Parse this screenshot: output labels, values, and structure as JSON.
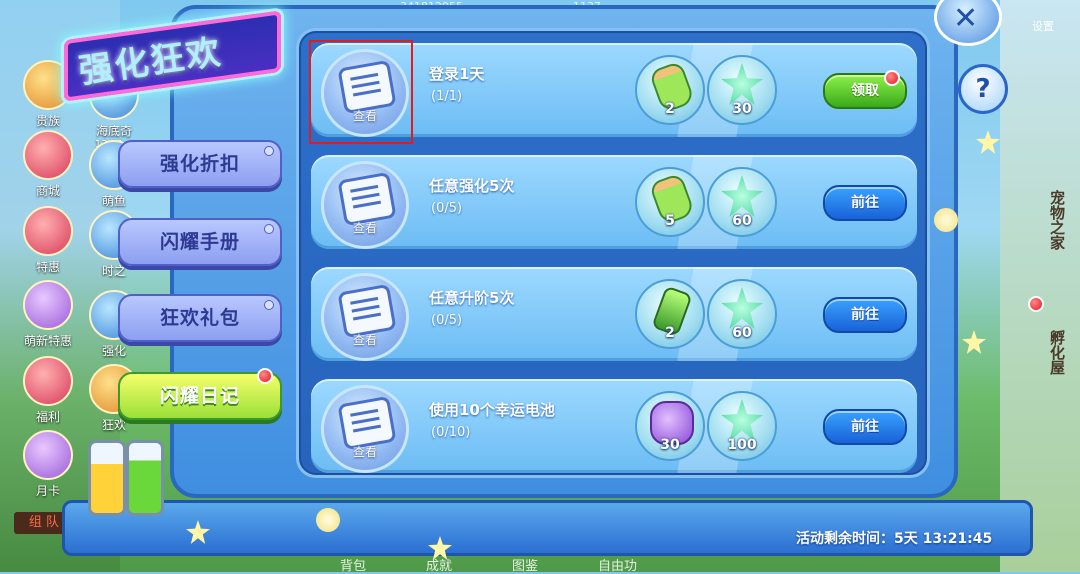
{
  "title": "强化狂欢",
  "top_strip": [
    "341812955",
    "1137"
  ],
  "settings_label": "设置",
  "left_icons": [
    {
      "label": "贵族",
      "style": ""
    },
    {
      "label": "海底奇",
      "style": "b"
    },
    {
      "label": "商城",
      "style": "r"
    },
    {
      "label": "萌鱼",
      "style": "b"
    },
    {
      "label": "特惠",
      "style": "r"
    },
    {
      "label": "时之",
      "style": "b"
    },
    {
      "label": "萌新特惠",
      "style": "p"
    },
    {
      "label": "强化",
      "style": "b"
    },
    {
      "label": "福利",
      "style": "r"
    },
    {
      "label": "狂欢",
      "style": ""
    },
    {
      "label": "月卡",
      "style": "p"
    }
  ],
  "left_icon_time": "13:21:4",
  "right_labels": [
    "宠物之家",
    "孵化屋"
  ],
  "tabs": [
    {
      "label": "强化折扣"
    },
    {
      "label": "闪耀手册"
    },
    {
      "label": "狂欢礼包"
    },
    {
      "label": "闪耀日记"
    }
  ],
  "tasks": [
    {
      "title": "登录1天",
      "progress": "(1/1)",
      "thumb_caption": "查看",
      "rewards": [
        {
          "icon": "potion",
          "qty": "2"
        },
        {
          "icon": "star",
          "qty": "30"
        }
      ],
      "button": "领取",
      "button_style": "green"
    },
    {
      "title": "任意强化5次",
      "progress": "(0/5)",
      "thumb_caption": "查看",
      "rewards": [
        {
          "icon": "potion",
          "qty": "5"
        },
        {
          "icon": "star",
          "qty": "60"
        }
      ],
      "button": "前往",
      "button_style": "blue"
    },
    {
      "title": "任意升阶5次",
      "progress": "(0/5)",
      "thumb_caption": "查看",
      "rewards": [
        {
          "icon": "bottle",
          "qty": "2"
        },
        {
          "icon": "star",
          "qty": "60"
        }
      ],
      "button": "前往",
      "button_style": "blue"
    },
    {
      "title": "使用10个幸运电池",
      "progress": "(0/10)",
      "thumb_caption": "查看",
      "rewards": [
        {
          "icon": "bag",
          "qty": "30"
        },
        {
          "icon": "star",
          "qty": "100"
        }
      ],
      "button": "前往",
      "button_style": "blue"
    }
  ],
  "timer_text": "活动剩余时间：5天 13:21:45",
  "team_label": "组 队",
  "bottom_nav": [
    "背包",
    "成就",
    "图鉴",
    "自由功"
  ],
  "help_icon": "?",
  "close_icon": "✕"
}
